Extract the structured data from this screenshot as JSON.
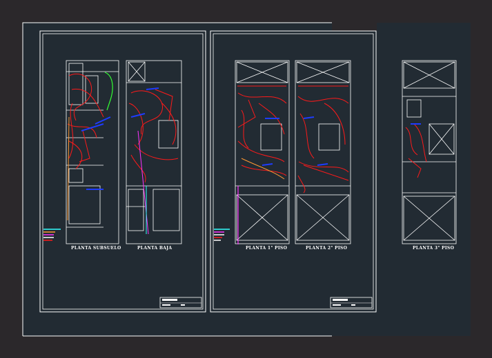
{
  "drawing": {
    "background_color": "#2b282b",
    "modelspace_color": "#222b33",
    "line_color": "#ffffff",
    "wire_color": "#ff1a1a",
    "accent_colors": {
      "blue": "#1e3cff",
      "green": "#33ff33",
      "magenta": "#ff33ff",
      "orange": "#ff9933",
      "cyan": "#33ffff"
    },
    "plans": [
      {
        "label": "PLANTA SUBSUELO"
      },
      {
        "label": "PLANTA BAJA"
      },
      {
        "label": "PLANTA 1° PISO"
      },
      {
        "label": "PLANTA 2° PISO"
      },
      {
        "label": "PLANTA 3° PISO"
      }
    ]
  }
}
